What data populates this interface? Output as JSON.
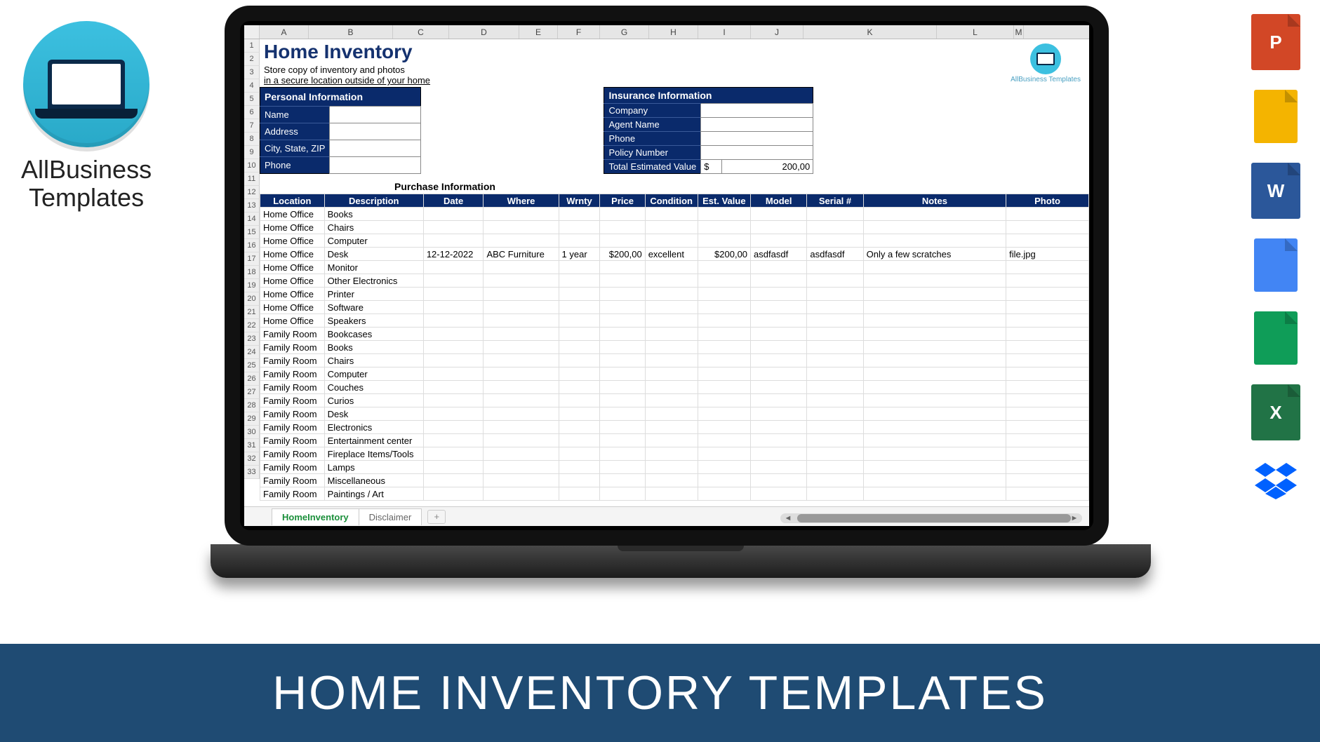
{
  "logo": {
    "brand_line1": "AllBusiness",
    "brand_line2": "Templates"
  },
  "banner": {
    "text": "HOME INVENTORY TEMPLATES"
  },
  "file_icons": {
    "ppt": "P",
    "slides": "",
    "word": "W",
    "docs": "",
    "sheets": "",
    "excel": "X",
    "dropbox": "⬧"
  },
  "sheet": {
    "col_letters": [
      "A",
      "B",
      "C",
      "D",
      "E",
      "F",
      "G",
      "H",
      "I",
      "J",
      "K",
      "L",
      "M"
    ],
    "row_numbers": [
      "1",
      "2",
      "3",
      "4",
      "5",
      "6",
      "7",
      "8",
      "9",
      "10",
      "11",
      "12",
      "13",
      "14",
      "15",
      "16",
      "17",
      "18",
      "19",
      "20",
      "21",
      "22",
      "23",
      "24",
      "25",
      "26",
      "27",
      "28",
      "29",
      "30",
      "31",
      "32",
      "33"
    ],
    "title": "Home Inventory",
    "subtitle1": "Store copy of inventory and photos",
    "subtitle2": "in a secure location outside of your home",
    "brand_mini": "AllBusiness Templates",
    "personal": {
      "header": "Personal Information",
      "fields": [
        "Name",
        "Address",
        "City, State, ZIP",
        "Phone"
      ]
    },
    "insurance": {
      "header": "Insurance Information",
      "fields": [
        "Company",
        "Agent Name",
        "Phone",
        "Policy Number",
        "Total Estimated Value"
      ],
      "currency": "$",
      "total": "200,00"
    },
    "purchase_header": "Purchase Information",
    "grid_headers": [
      "Location",
      "Description",
      "Date",
      "Where",
      "Wrnty",
      "Price",
      "Condition",
      "Est. Value",
      "Model",
      "Serial #",
      "Notes",
      "Photo"
    ],
    "rows": [
      {
        "loc": "Home Office",
        "desc": "Books"
      },
      {
        "loc": "Home Office",
        "desc": "Chairs"
      },
      {
        "loc": "Home Office",
        "desc": "Computer"
      },
      {
        "loc": "Home Office",
        "desc": "Desk",
        "date": "12-12-2022",
        "where": "ABC Furniture",
        "wrnty": "1 year",
        "price": "$200,00",
        "cond": "excellent",
        "est": "$200,00",
        "model": "asdfasdf",
        "serial": "asdfasdf",
        "notes": "Only a few scratches",
        "photo": "file.jpg"
      },
      {
        "loc": "Home Office",
        "desc": "Monitor"
      },
      {
        "loc": "Home Office",
        "desc": "Other Electronics"
      },
      {
        "loc": "Home Office",
        "desc": "Printer"
      },
      {
        "loc": "Home Office",
        "desc": "Software"
      },
      {
        "loc": "Home Office",
        "desc": "Speakers"
      },
      {
        "loc": "Family Room",
        "desc": "Bookcases"
      },
      {
        "loc": "Family Room",
        "desc": "Books"
      },
      {
        "loc": "Family Room",
        "desc": "Chairs"
      },
      {
        "loc": "Family Room",
        "desc": "Computer"
      },
      {
        "loc": "Family Room",
        "desc": "Couches"
      },
      {
        "loc": "Family Room",
        "desc": "Curios"
      },
      {
        "loc": "Family Room",
        "desc": "Desk"
      },
      {
        "loc": "Family Room",
        "desc": "Electronics"
      },
      {
        "loc": "Family Room",
        "desc": "Entertainment center"
      },
      {
        "loc": "Family Room",
        "desc": "Fireplace Items/Tools"
      },
      {
        "loc": "Family Room",
        "desc": "Lamps"
      },
      {
        "loc": "Family Room",
        "desc": "Miscellaneous"
      },
      {
        "loc": "Family Room",
        "desc": "Paintings / Art"
      }
    ],
    "tabs": {
      "active": "HomeInventory",
      "other": "Disclaimer",
      "add": "+"
    }
  }
}
